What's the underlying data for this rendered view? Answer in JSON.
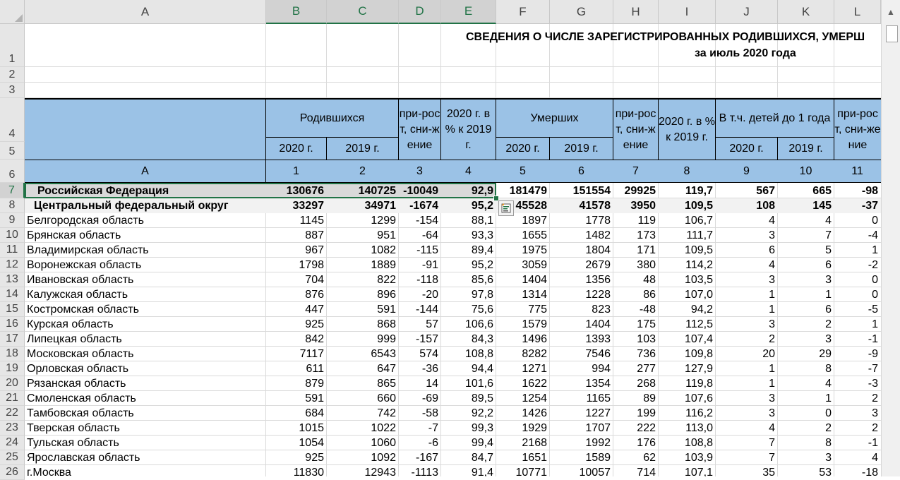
{
  "columns": [
    "A",
    "B",
    "C",
    "D",
    "E",
    "F",
    "G",
    "H",
    "I",
    "J",
    "K",
    "L"
  ],
  "selected_columns": [
    "B",
    "C",
    "D",
    "E"
  ],
  "title": {
    "line1": "СВЕДЕНИЯ О ЧИСЛЕ ЗАРЕГИСТРИРОВАННЫХ  РОДИВШИХСЯ, УМЕРШ",
    "line2": "за июль 2020 года"
  },
  "header": {
    "born": "Родившихся",
    "born_2020": "2020 г.",
    "born_2019": "2019 г.",
    "born_change": "при-рост, сни-жение",
    "born_pct": "2020 г. в % к 2019 г.",
    "died": "Умерших",
    "died_2020": "2020 г.",
    "died_2019": "2019 г.",
    "died_change": "при-рост, сни-жение",
    "died_pct": "2020 г. в % к 2019 г.",
    "infants": "В т.ч. детей до 1 года",
    "infants_2020": "2020 г.",
    "infants_2019": "2019 г.",
    "infants_change": "при-рост, сни-жение"
  },
  "code_row": [
    "А",
    "1",
    "2",
    "3",
    "4",
    "5",
    "6",
    "7",
    "8",
    "9",
    "10",
    "11"
  ],
  "rows": [
    {
      "n": "7",
      "name": "Российская Федерация",
      "v": [
        "130676",
        "140725",
        "-10049",
        "92,9",
        "181479",
        "151554",
        "29925",
        "119,7",
        "567",
        "665",
        "-98"
      ]
    },
    {
      "n": "8",
      "name": "Центральный федеральный округ",
      "v": [
        "33297",
        "34971",
        "-1674",
        "95,2",
        "45528",
        "41578",
        "3950",
        "109,5",
        "108",
        "145",
        "-37"
      ]
    },
    {
      "n": "9",
      "name": "Белгородская область",
      "v": [
        "1145",
        "1299",
        "-154",
        "88,1",
        "1897",
        "1778",
        "119",
        "106,7",
        "4",
        "4",
        "0"
      ]
    },
    {
      "n": "10",
      "name": "Брянская область",
      "v": [
        "887",
        "951",
        "-64",
        "93,3",
        "1655",
        "1482",
        "173",
        "111,7",
        "3",
        "7",
        "-4"
      ]
    },
    {
      "n": "11",
      "name": "Владимирская область",
      "v": [
        "967",
        "1082",
        "-115",
        "89,4",
        "1975",
        "1804",
        "171",
        "109,5",
        "6",
        "5",
        "1"
      ]
    },
    {
      "n": "12",
      "name": "Воронежская область",
      "v": [
        "1798",
        "1889",
        "-91",
        "95,2",
        "3059",
        "2679",
        "380",
        "114,2",
        "4",
        "6",
        "-2"
      ]
    },
    {
      "n": "13",
      "name": "Ивановская область",
      "v": [
        "704",
        "822",
        "-118",
        "85,6",
        "1404",
        "1356",
        "48",
        "103,5",
        "3",
        "3",
        "0"
      ]
    },
    {
      "n": "14",
      "name": "Калужская область",
      "v": [
        "876",
        "896",
        "-20",
        "97,8",
        "1314",
        "1228",
        "86",
        "107,0",
        "1",
        "1",
        "0"
      ]
    },
    {
      "n": "15",
      "name": "Костромская область",
      "v": [
        "447",
        "591",
        "-144",
        "75,6",
        "775",
        "823",
        "-48",
        "94,2",
        "1",
        "6",
        "-5"
      ]
    },
    {
      "n": "16",
      "name": "Курская область",
      "v": [
        "925",
        "868",
        "57",
        "106,6",
        "1579",
        "1404",
        "175",
        "112,5",
        "3",
        "2",
        "1"
      ]
    },
    {
      "n": "17",
      "name": "Липецкая область",
      "v": [
        "842",
        "999",
        "-157",
        "84,3",
        "1496",
        "1393",
        "103",
        "107,4",
        "2",
        "3",
        "-1"
      ]
    },
    {
      "n": "18",
      "name": "Московская область",
      "v": [
        "7117",
        "6543",
        "574",
        "108,8",
        "8282",
        "7546",
        "736",
        "109,8",
        "20",
        "29",
        "-9"
      ]
    },
    {
      "n": "19",
      "name": "Орловская область",
      "v": [
        "611",
        "647",
        "-36",
        "94,4",
        "1271",
        "994",
        "277",
        "127,9",
        "1",
        "8",
        "-7"
      ]
    },
    {
      "n": "20",
      "name": "Рязанская область",
      "v": [
        "879",
        "865",
        "14",
        "101,6",
        "1622",
        "1354",
        "268",
        "119,8",
        "1",
        "4",
        "-3"
      ]
    },
    {
      "n": "21",
      "name": "Смоленская область",
      "v": [
        "591",
        "660",
        "-69",
        "89,5",
        "1254",
        "1165",
        "89",
        "107,6",
        "3",
        "1",
        "2"
      ]
    },
    {
      "n": "22",
      "name": "Тамбовская область",
      "v": [
        "684",
        "742",
        "-58",
        "92,2",
        "1426",
        "1227",
        "199",
        "116,2",
        "3",
        "0",
        "3"
      ]
    },
    {
      "n": "23",
      "name": "Тверская область",
      "v": [
        "1015",
        "1022",
        "-7",
        "99,3",
        "1929",
        "1707",
        "222",
        "113,0",
        "4",
        "2",
        "2"
      ]
    },
    {
      "n": "24",
      "name": "Тульская область",
      "v": [
        "1054",
        "1060",
        "-6",
        "99,4",
        "2168",
        "1992",
        "176",
        "108,8",
        "7",
        "8",
        "-1"
      ]
    },
    {
      "n": "25",
      "name": "Ярославская область",
      "v": [
        "925",
        "1092",
        "-167",
        "84,7",
        "1651",
        "1589",
        "62",
        "103,9",
        "7",
        "3",
        "4"
      ]
    },
    {
      "n": "26",
      "name": "г.Москва",
      "v": [
        "11830",
        "12943",
        "-1113",
        "91,4",
        "10771",
        "10057",
        "714",
        "107,1",
        "35",
        "53",
        "-18"
      ]
    }
  ]
}
